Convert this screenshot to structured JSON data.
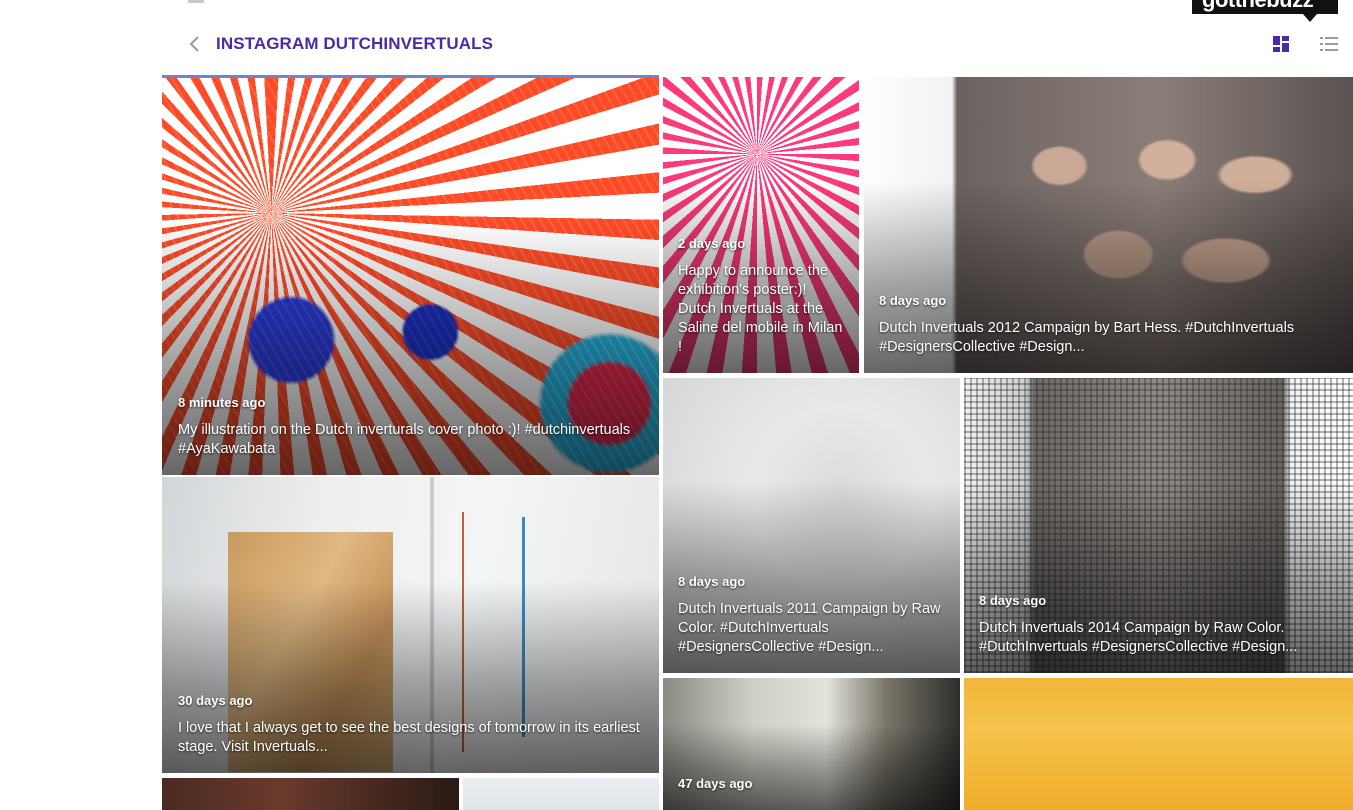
{
  "brand": {
    "label": "gotthebuzz"
  },
  "header": {
    "title": "INSTAGRAM DUTCHINVERTUALS"
  },
  "posts": [
    {
      "time": "8 minutes ago",
      "caption": "My illustration on the Dutch invert­urals cover photo :)! #dutchinvertuals #AyaKawabata"
    },
    {
      "time": "2 days ago",
      "caption": "Happy to announce the exhibition's poster:)! Dutch Invertuals at the Saline del mobile in Milan !"
    },
    {
      "time": "8 days ago",
      "caption": "Dutch Invertuals 2012 Campaign by Bart Hess. #DutchInvertuals #DesignersCollective #Design..."
    },
    {
      "time": "30 days ago",
      "caption": "I love that I always get to see the best designs of tomorrow in its earliest stage. Visit Invertuals..."
    },
    {
      "time": "8 days ago",
      "caption": "Dutch Invertuals 2011 Campaign by Raw Color. #DutchInvertuals #DesignersCollective #Design..."
    },
    {
      "time": "8 days ago",
      "caption": "Dutch Invertuals 2014 Campaign by Raw Color. #DutchInvertuals #DesignersCollective #Design..."
    },
    {
      "time": "47 days ago",
      "caption": ""
    },
    {
      "time": "",
      "caption": ""
    },
    {
      "time": "",
      "caption": ""
    },
    {
      "time": "",
      "caption": ""
    }
  ],
  "colors": {
    "title": "#4b2aa8",
    "active_border": "#6e86c8"
  }
}
